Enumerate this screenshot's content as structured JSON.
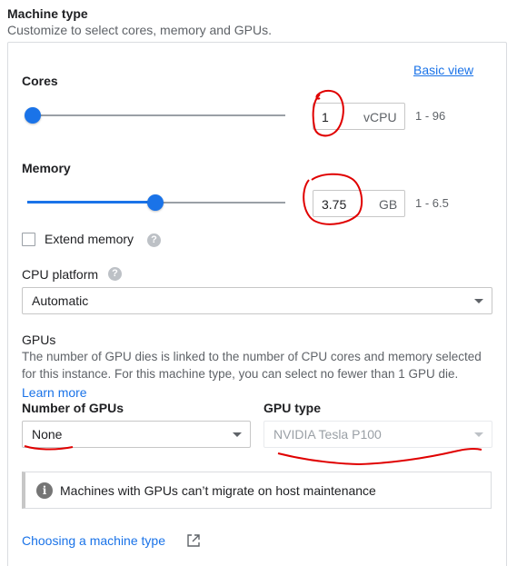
{
  "header": {
    "title": "Machine type",
    "subtitle": "Customize to select cores, memory and GPUs."
  },
  "basic_view_link": "Basic view",
  "cores": {
    "label": "Cores",
    "value": "1",
    "unit": "vCPU",
    "range": "1 - 96",
    "slider_fraction": 0.0
  },
  "memory": {
    "label": "Memory",
    "value": "3.75",
    "unit": "GB",
    "range": "1 - 6.5",
    "slider_fraction": 0.5
  },
  "extend_memory": {
    "label": "Extend memory",
    "checked": false,
    "help_icon": "help-icon"
  },
  "cpu_platform": {
    "label": "CPU platform",
    "selected": "Automatic",
    "help_icon": "help-icon"
  },
  "gpus": {
    "title": "GPUs",
    "description_line1": "The number of GPU dies is linked to the number of CPU cores and memory selected",
    "description_line2": "for this instance. For this machine type, you can select no fewer than 1 GPU die.",
    "learn_more": "Learn more",
    "number_label": "Number of GPUs",
    "number_selected": "None",
    "type_label": "GPU type",
    "type_selected": "NVIDIA Tesla P100"
  },
  "notice": {
    "icon": "info-icon",
    "text": "Machines with GPUs can’t migrate on host maintenance"
  },
  "footer_link": {
    "text": "Choosing a machine type",
    "icon": "external-link-icon"
  },
  "colors": {
    "accent": "#1a73e8",
    "annotation": "#e00000"
  }
}
